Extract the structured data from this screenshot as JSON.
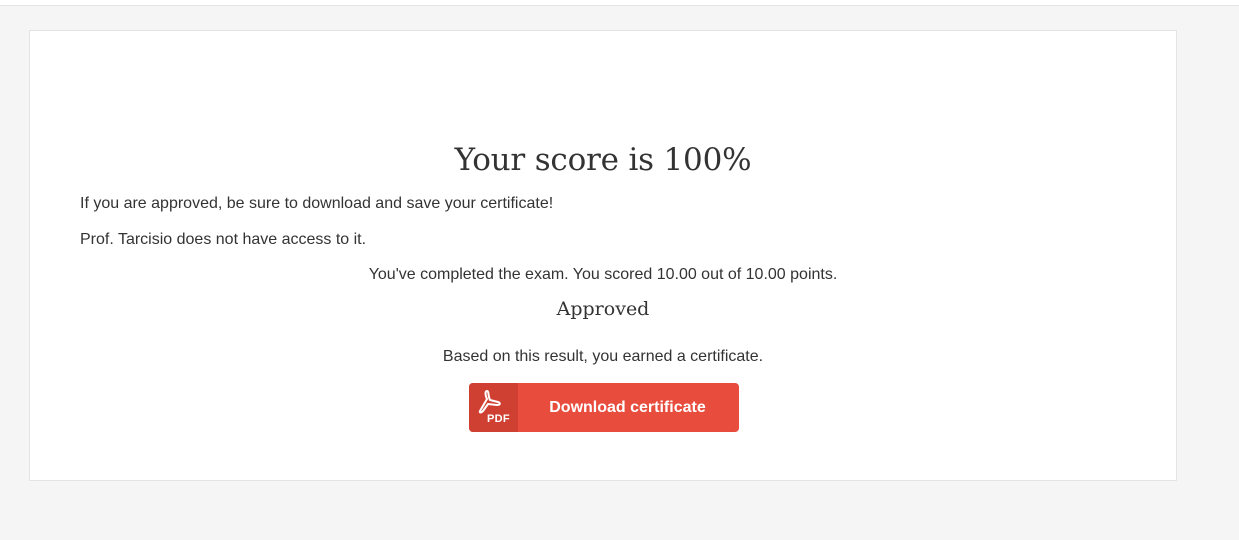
{
  "result": {
    "title": "Your score is 100%",
    "note_line_1": "If you are approved, be sure to download and save your certificate!",
    "note_line_2": "Prof. Tarcisio does not have access to it.",
    "completed_text": "You've completed the exam. You scored 10.00 out of 10.00 points.",
    "status": "Approved",
    "earned_text": "Based on this result, you earned a certificate."
  },
  "download": {
    "icon": "pdf-icon",
    "icon_text": "PDF",
    "label": "Download certificate",
    "color": "#e84c3d",
    "icon_bg_color": "#cf4032"
  }
}
